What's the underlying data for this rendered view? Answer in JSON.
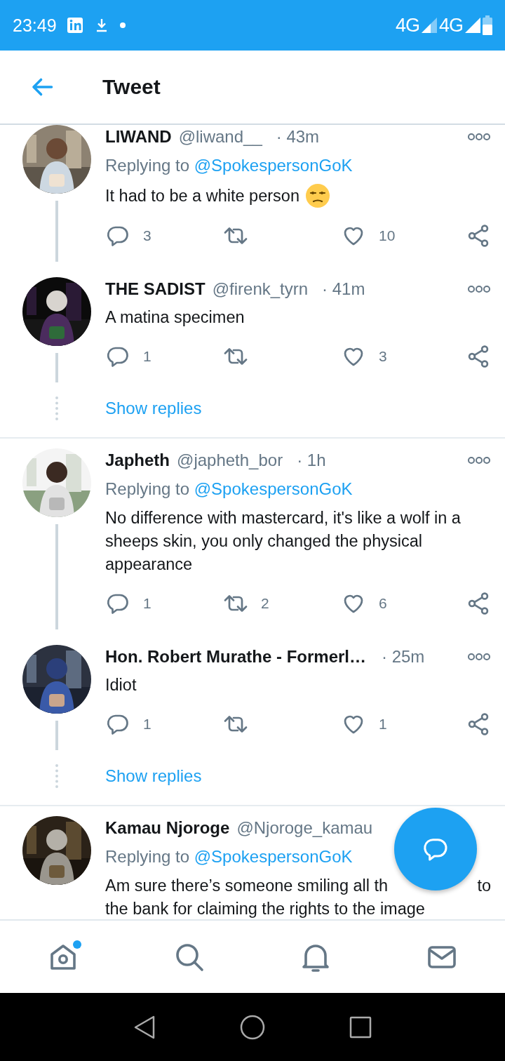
{
  "status_bar": {
    "time": "23:49",
    "network_labels": [
      "4G",
      "4G"
    ]
  },
  "header": {
    "title": "Tweet"
  },
  "conversations": [
    {
      "tweets": [
        {
          "name": "LIWAND",
          "handle": "@liwand__",
          "time": "· 43m",
          "replying_label": "Replying to",
          "replying_to": "@SpokespersonGoK",
          "body": "It had to be a white person",
          "has_emoji": true,
          "counts": {
            "reply": "3",
            "like": "10"
          },
          "thread_continues": true
        },
        {
          "name": "THE SADIST",
          "handle": "@firenk_tyrn",
          "time": "· 41m",
          "body": "A matina specimen",
          "counts": {
            "reply": "1",
            "like": "3"
          },
          "thread_continues": true
        }
      ],
      "show_replies": "Show replies"
    },
    {
      "tweets": [
        {
          "name": "Japheth",
          "handle": "@japheth_bor",
          "time": "· 1h",
          "replying_label": "Replying to",
          "replying_to": "@SpokespersonGoK",
          "body": "No difference with mastercard, it's like a wolf in a sheeps skin, you only changed the physical appearance",
          "counts": {
            "reply": "1",
            "retweet": "2",
            "like": "6"
          },
          "thread_continues": true
        },
        {
          "name": "Hon. Robert Murathe - Formerl…",
          "time": "· 25m",
          "body": "Idiot",
          "counts": {
            "reply": "1",
            "like": "1"
          },
          "thread_continues": true
        }
      ],
      "show_replies": "Show replies"
    },
    {
      "tweets": [
        {
          "name": "Kamau Njoroge",
          "handle": "@Njoroge_kamau",
          "replying_label": "Replying to",
          "replying_to": "@SpokespersonGoK",
          "body_fragments": [
            "Am sure there’s someone smiling all th",
            "to",
            "the bank for claiming the rights to the image"
          ]
        }
      ]
    }
  ],
  "bottom_nav": [
    {
      "kind": "home",
      "selected": false,
      "badge": true
    },
    {
      "kind": "search",
      "selected": false
    },
    {
      "kind": "notifications",
      "selected": false
    },
    {
      "kind": "messages",
      "selected": false
    }
  ]
}
